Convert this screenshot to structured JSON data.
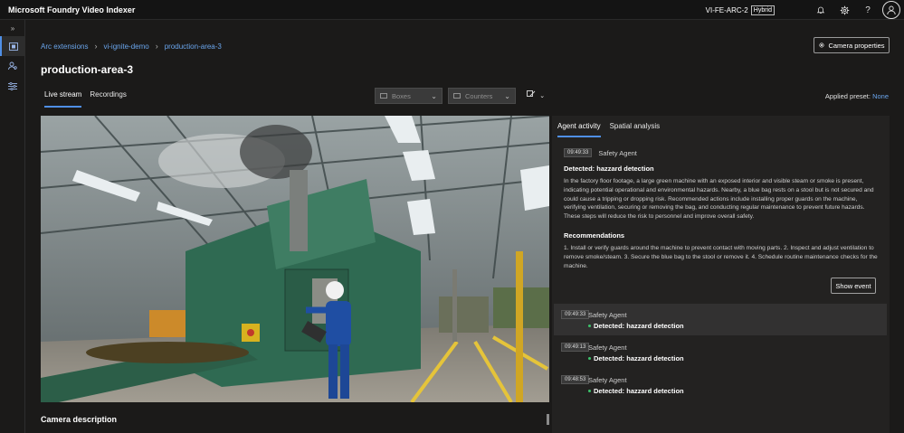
{
  "header": {
    "app_title": "Microsoft Foundry Video Indexer",
    "account": "VI-FE-ARC-2",
    "account_badge": "Hybrid",
    "icons": [
      "bell-icon",
      "gear-icon",
      "help-icon",
      "avatar-icon"
    ]
  },
  "rail": {
    "icons": [
      "expand-icon",
      "video-library-icon",
      "people-icon",
      "filter-settings-icon"
    ]
  },
  "breadcrumb": [
    "Arc extensions",
    "vi-ignite-demo",
    "production-area-3"
  ],
  "page_title": "production-area-3",
  "camera_properties_label": "Camera properties",
  "tabs": [
    {
      "label": "Live stream",
      "active": true
    },
    {
      "label": "Recordings",
      "active": false
    }
  ],
  "toolbar": {
    "boxes_placeholder": "Boxes",
    "counters_placeholder": "Counters",
    "applied_preset_label": "Applied preset:",
    "applied_preset_value": "None"
  },
  "camera_description_label": "Camera description",
  "panel": {
    "tabs": [
      {
        "label": "Agent activity",
        "active": true
      },
      {
        "label": "Spatial analysis",
        "active": false
      }
    ],
    "expanded_event": {
      "timestamp": "09:49:33",
      "agent": "Safety Agent",
      "title": "Detected: hazzard detection",
      "description": "In the factory floor footage, a large green machine with an exposed interior and visible steam or smoke is present, indicating potential operational and environmental hazards. Nearby, a blue bag rests on a stool but is not secured and could cause a tripping or dropping risk. Recommended actions include installing proper guards on the machine, verifying ventilation, securing or removing the bag, and conducting regular maintenance to prevent future hazards. These steps will reduce the risk to personnel and improve overall safety.",
      "recommendations_title": "Recommendations",
      "recommendations": "1. Install or verify guards around the machine to prevent contact with moving parts. 2. Inspect and adjust ventilation to remove smoke/steam. 3. Secure the blue bag to the stool or remove it. 4. Schedule routine maintenance checks for the machine.",
      "show_event_label": "Show event"
    },
    "events": [
      {
        "timestamp": "09:49:33",
        "agent": "Safety Agent",
        "detection": "Detected: hazzard detection"
      },
      {
        "timestamp": "09:49:13",
        "agent": "Safety Agent",
        "detection": "Detected: hazzard detection"
      },
      {
        "timestamp": "09:48:53",
        "agent": "Safety Agent",
        "detection": "Detected: hazzard detection"
      }
    ]
  },
  "colors": {
    "accent": "#4f8fe6",
    "link": "#6aa5ec",
    "status_dot": "#3cc36b",
    "background": "#1b1a19",
    "panel": "#232221"
  }
}
